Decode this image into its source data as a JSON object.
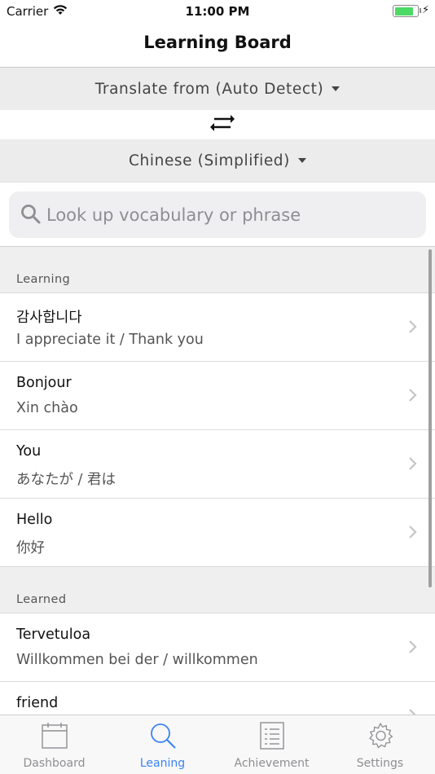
{
  "status_bar": {
    "carrier": "Carrier",
    "time": "11:00 PM",
    "battery_level": 0.85
  },
  "nav": {
    "title": "Learning Board"
  },
  "translate": {
    "from_label": "Translate from (Auto Detect)",
    "to_label": "Chinese (Simplified)"
  },
  "search": {
    "placeholder": "Look up vocabulary or phrase",
    "value": ""
  },
  "sections": [
    {
      "title": "Learning",
      "items": [
        {
          "term": "감사합니다",
          "meaning": "I appreciate it / Thank you"
        },
        {
          "term": "Bonjour",
          "meaning": "Xin chào"
        },
        {
          "term": "You",
          "meaning": "あなたが / 君は"
        },
        {
          "term": "Hello",
          "meaning": "你好"
        }
      ]
    },
    {
      "title": "Learned",
      "items": [
        {
          "term": "Tervetuloa",
          "meaning": "Willkommen bei der / willkommen"
        },
        {
          "term": "friend",
          "meaning": ""
        }
      ]
    }
  ],
  "tabs": [
    {
      "label": "Dashboard",
      "icon": "calendar-icon",
      "active": false
    },
    {
      "label": "Leaning",
      "icon": "search-icon",
      "active": true
    },
    {
      "label": "Achievement",
      "icon": "list-icon",
      "active": false
    },
    {
      "label": "Settings",
      "icon": "gear-icon",
      "active": false
    }
  ],
  "colors": {
    "accent": "#3a82f7",
    "inactive": "#8e8e93",
    "battery": "#4cd964"
  }
}
